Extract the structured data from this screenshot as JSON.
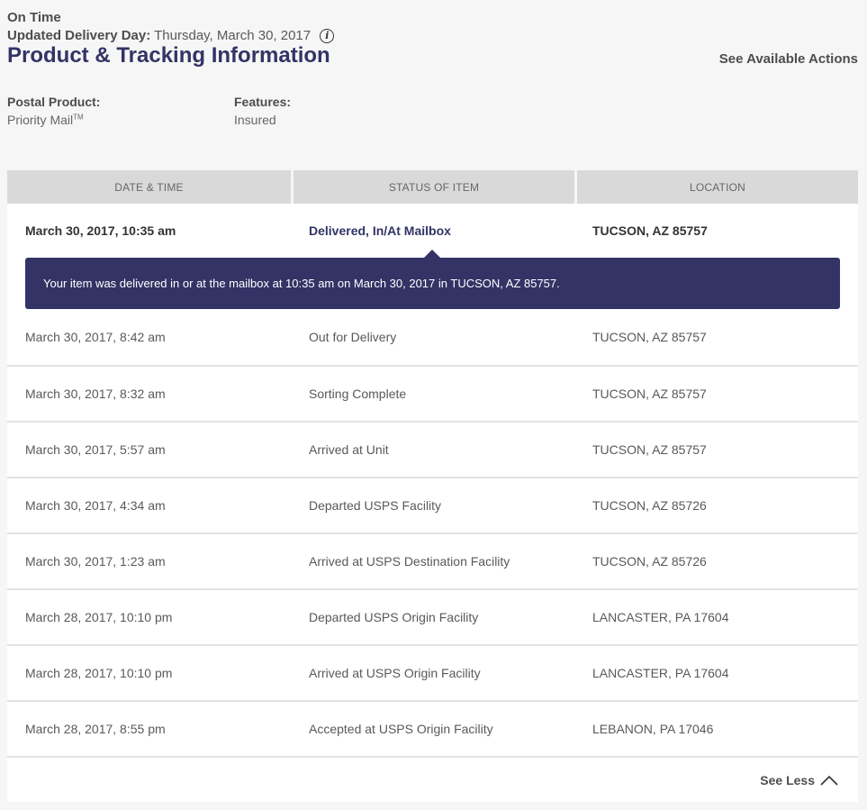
{
  "header": {
    "status": "On Time",
    "delivery_label": "Updated Delivery Day:",
    "delivery_value": "Thursday, March 30, 2017",
    "title": "Product & Tracking Information",
    "actions_link": "See Available Actions"
  },
  "meta": {
    "product_label": "Postal Product:",
    "product_value": "Priority Mail",
    "product_tm": "TM",
    "features_label": "Features:",
    "features_value": "Insured"
  },
  "table": {
    "headers": [
      "DATE & TIME",
      "STATUS OF ITEM",
      "LOCATION"
    ],
    "first": {
      "date": "March 30, 2017, 10:35 am",
      "status": "Delivered, In/At Mailbox",
      "location": "TUCSON, AZ 85757",
      "detail": "Your item was delivered in or at the mailbox at 10:35 am on March 30, 2017 in TUCSON, AZ 85757."
    },
    "rows": [
      {
        "date": "March 30, 2017, 8:42 am",
        "status": "Out for Delivery",
        "location": "TUCSON, AZ 85757"
      },
      {
        "date": "March 30, 2017, 8:32 am",
        "status": "Sorting Complete",
        "location": "TUCSON, AZ 85757"
      },
      {
        "date": "March 30, 2017, 5:57 am",
        "status": "Arrived at Unit",
        "location": "TUCSON, AZ 85757"
      },
      {
        "date": "March 30, 2017, 4:34 am",
        "status": "Departed USPS Facility",
        "location": "TUCSON, AZ 85726"
      },
      {
        "date": "March 30, 2017, 1:23 am",
        "status": "Arrived at USPS Destination Facility",
        "location": "TUCSON, AZ 85726"
      },
      {
        "date": "March 28, 2017, 10:10 pm",
        "status": "Departed USPS Origin Facility",
        "location": "LANCASTER, PA 17604"
      },
      {
        "date": "March 28, 2017, 10:10 pm",
        "status": "Arrived at USPS Origin Facility",
        "location": "LANCASTER, PA 17604"
      },
      {
        "date": "March 28, 2017, 8:55 pm",
        "status": "Accepted at USPS Origin Facility",
        "location": "LEBANON, PA 17046"
      }
    ]
  },
  "footer": {
    "see_less": "See Less"
  },
  "icons": {
    "info": "info-icon",
    "collapse": "chevron-up-icon"
  },
  "colors": {
    "brand": "#333366",
    "header_bg": "#d9d9d9",
    "page_bg": "#f6f6f6"
  }
}
